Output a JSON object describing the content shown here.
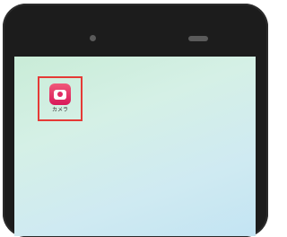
{
  "home_screen": {
    "apps": [
      {
        "label": "カメラ",
        "icon": "camera-icon",
        "icon_color": "#e0245e",
        "highlighted": true,
        "highlight_color": "#e53a36"
      }
    ]
  }
}
